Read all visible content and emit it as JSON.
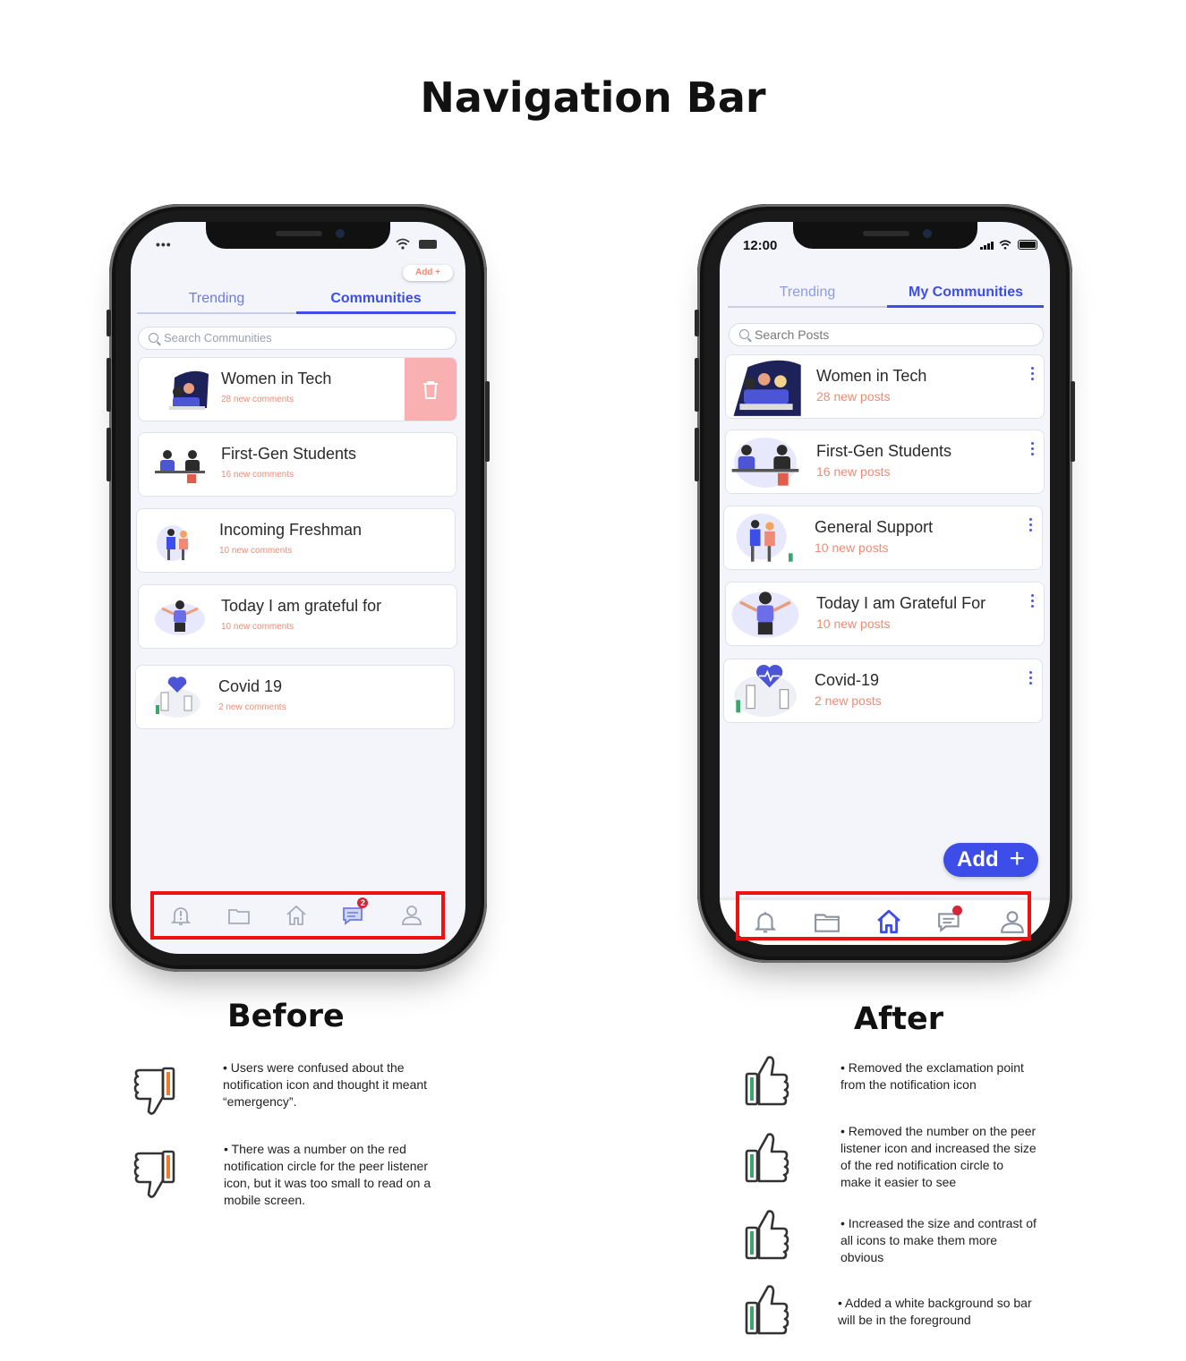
{
  "title": "Navigation Bar",
  "before": {
    "heading": "Before",
    "status": {
      "dots": "•••"
    },
    "add_label": "Add +",
    "tabs": [
      {
        "label": "Trending"
      },
      {
        "label": "Communities"
      }
    ],
    "search_placeholder": "Search Communities",
    "communities": [
      {
        "name": "Women in Tech",
        "sub": "28 new comments"
      },
      {
        "name": "First-Gen Students",
        "sub": "16 new comments"
      },
      {
        "name": "Incoming Freshman",
        "sub": "10 new comments"
      },
      {
        "name": "Today I am grateful for",
        "sub": "10 new comments"
      },
      {
        "name": "Covid 19",
        "sub": "2 new comments"
      }
    ],
    "badge_count": "2",
    "notes": [
      "• Users were confused about the notification icon and thought it meant “emergency”.",
      "• There was a number on the red notification circle for the peer listener icon, but it was too small to read on a mobile screen."
    ]
  },
  "after": {
    "heading": "After",
    "status": {
      "time": "12:00"
    },
    "tabs": [
      {
        "label": "Trending"
      },
      {
        "label": "My Communities"
      }
    ],
    "search_placeholder": "Search Posts",
    "communities": [
      {
        "name": "Women in Tech",
        "sub": "28 new posts"
      },
      {
        "name": "First-Gen Students",
        "sub": "16 new posts"
      },
      {
        "name": "General Support",
        "sub": "10 new posts"
      },
      {
        "name": "Today I am Grateful For",
        "sub": "10 new posts"
      },
      {
        "name": "Covid-19",
        "sub": "2 new posts"
      }
    ],
    "add_label": "Add",
    "add_plus": "+",
    "notes": [
      "• Removed the exclamation point from the notification icon",
      "• Removed the number on the peer listener icon and increased the size of the red notification circle to make it easier to see",
      "• Increased the size and contrast of all icons to make them more obvious",
      "•  Added a white background so bar will be in the foreground"
    ]
  },
  "colors": {
    "accent": "#3d4de8",
    "coral": "#f08b73",
    "highlight": "#ee1111",
    "thumb_up_accent": "#3aa66b",
    "thumb_down_accent": "#f07b2f"
  }
}
